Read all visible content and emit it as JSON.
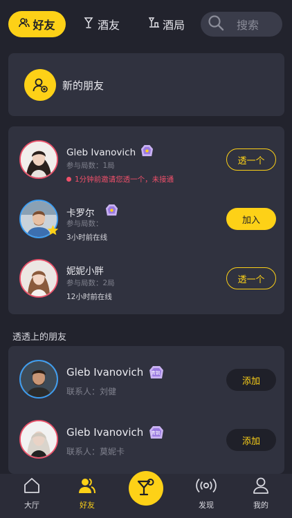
{
  "colors": {
    "accent": "#fdd117",
    "background": "#22232d",
    "card": "#30323f",
    "alert": "#f0506a"
  },
  "topbar": {
    "tab_friends": "好友",
    "tab_drinkmates": "酒友",
    "tab_parties": "酒局",
    "search_placeholder": "搜索"
  },
  "new_friends": {
    "label": "新的朋友",
    "icon": "add-user-icon"
  },
  "friends": [
    {
      "name": "Gleb Ivanovich",
      "meta": "参与局数：1局",
      "status": "1分钟前邀请您透一个，未接通",
      "status_alert": true,
      "action": "透一个",
      "badge": "vip-badge-icon"
    },
    {
      "name": "卡罗尔",
      "meta": "参与局数：",
      "status": "3小时前在线",
      "status_alert": false,
      "action": "加入",
      "badge": "vip-badge-icon"
    },
    {
      "name": "妮妮小胖",
      "meta": "参与局数：2局",
      "status": "12小时前在线",
      "status_alert": false,
      "action": "透一个"
    }
  ],
  "suggest": {
    "section_title": "透透上的朋友",
    "items": [
      {
        "name": "Gleb Ivanovich",
        "contact": "联系人：刘健",
        "action": "添加",
        "badge_text": "青铜"
      },
      {
        "name": "Gleb Ivanovich",
        "contact": "联系人：莫妮卡",
        "action": "添加",
        "badge_text": "青铜"
      }
    ]
  },
  "bottom_nav": {
    "hall": "大厅",
    "friends": "好友",
    "discover": "发现",
    "mine": "我的"
  }
}
